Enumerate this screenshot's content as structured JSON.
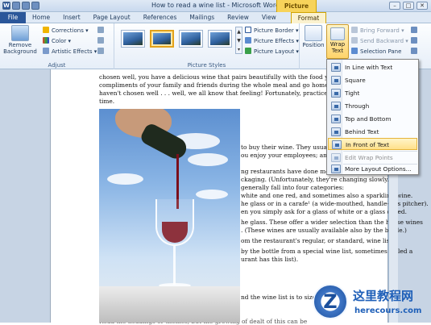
{
  "window": {
    "title": "How to read a wine list - Microsoft Word",
    "context_tab_title": "Picture Tools",
    "word_icon": "W"
  },
  "tabs": [
    "File",
    "Home",
    "Insert",
    "Page Layout",
    "References",
    "Mailings",
    "Review",
    "View",
    "Format"
  ],
  "active_tab": "Format",
  "ribbon": {
    "remove_background": "Remove Background",
    "corrections": "Corrections",
    "color": "Color",
    "artistic_effects": "Artistic Effects",
    "adjust_label": "Adjust",
    "picture_border": "Picture Border",
    "picture_effects": "Picture Effects",
    "picture_layout": "Picture Layout",
    "picture_styles_label": "Picture Styles",
    "position": "Position",
    "wrap_text_line1": "Wrap",
    "wrap_text_line2": "Text",
    "bring_forward": "Bring Forward",
    "send_backward": "Send Backward",
    "selection_pane": "Selection Pane"
  },
  "wrap_menu": {
    "items": [
      {
        "label": "In Line with Text",
        "dim": false
      },
      {
        "label": "Square",
        "dim": false
      },
      {
        "label": "Tight",
        "dim": false
      },
      {
        "label": "Through",
        "dim": false
      },
      {
        "label": "Top and Bottom",
        "dim": false
      },
      {
        "label": "Behind Text",
        "dim": false
      },
      {
        "label": "In Front of Text",
        "dim": false,
        "highlighted": true
      },
      {
        "label": "Edit Wrap Points",
        "dim": true
      },
      {
        "label": "More Layout Options...",
        "dim": false
      }
    ]
  },
  "document": {
    "top_lines": [
      "chosen well, you have a delicious wine that pairs beautifully with the food you've s",
      "compliments of your family  and friends during the whole meal  and go home feeling",
      "haven't chosen well . . . well,  we all know that feeling! Fortunately, practice does m",
      "time."
    ],
    "right_lines": [
      "to buy their wine. They usually m",
      "ou enjoy your employees; and you enjoy y",
      "ng restaurants have done more to h",
      "ckaging. (Unfortunately, they're changing slowly.)",
      "generally fall into four categories:",
      "white  and one red, and sometimes  also  a sparkling  wine.",
      "he glass or in a carafe¹ (a wide-mouthed,  handle-less pitcher).",
      "en you simply  ask for a glass of white  or a glass of red.",
      "he glass. These offer  a wider  selection  than the house wines",
      ". (These wines are usually available  also by the bottle.)",
      "om the restaurant's regular, or standard, wine list.",
      "by the bottle from a special wine list, sometimes  called a",
      "urant has this list).",
      "nd the wine list is to size up",
      "Read the headings or themes, but the growing of dealt of this can be"
    ]
  },
  "watermark": {
    "glyph": "Z",
    "line1": "这里教程网",
    "line2": "herecours.com"
  }
}
